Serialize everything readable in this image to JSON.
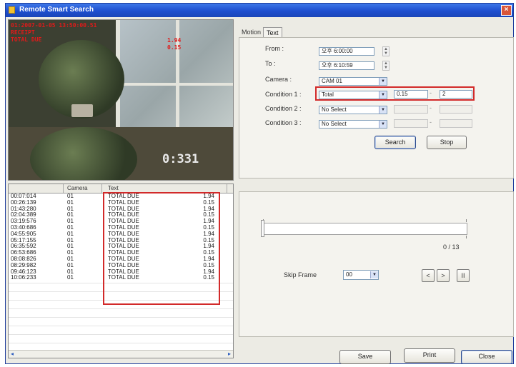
{
  "window": {
    "title": "Remote Smart Search"
  },
  "video": {
    "osd_line1": "01:2007-01-05 13:50:00.51",
    "osd_line2": "RECEIPT",
    "osd_line3": "TOTAL DUE",
    "osd_line4": "",
    "osd_right1": "1.94",
    "osd_right2": "0.15",
    "osd_time": "0:331"
  },
  "list": {
    "columns": [
      "",
      "Camera",
      "Text"
    ],
    "rows": [
      {
        "time": "00:07:014",
        "cam": "01",
        "text": "TOTAL DUE",
        "val": "1.94"
      },
      {
        "time": "00:26:139",
        "cam": "01",
        "text": "TOTAL DUE",
        "val": "0.15"
      },
      {
        "time": "01:43:280",
        "cam": "01",
        "text": "TOTAL DUE",
        "val": "1.94"
      },
      {
        "time": "02:04:389",
        "cam": "01",
        "text": "TOTAL DUE",
        "val": "0.15"
      },
      {
        "time": "03:19:576",
        "cam": "01",
        "text": "TOTAL DUE",
        "val": "1.94"
      },
      {
        "time": "03:40:686",
        "cam": "01",
        "text": "TOTAL DUE",
        "val": "0.15"
      },
      {
        "time": "04:55:905",
        "cam": "01",
        "text": "TOTAL DUE",
        "val": "1.94"
      },
      {
        "time": "05:17:155",
        "cam": "01",
        "text": "TOTAL DUE",
        "val": "0.15"
      },
      {
        "time": "06:35:592",
        "cam": "01",
        "text": "TOTAL DUE",
        "val": "1.94"
      },
      {
        "time": "06:53:686",
        "cam": "01",
        "text": "TOTAL DUE",
        "val": "0.15"
      },
      {
        "time": "08:08:826",
        "cam": "01",
        "text": "TOTAL DUE",
        "val": "1.94"
      },
      {
        "time": "08:29:982",
        "cam": "01",
        "text": "TOTAL DUE",
        "val": "0.15"
      },
      {
        "time": "09:46:123",
        "cam": "01",
        "text": "TOTAL DUE",
        "val": "1.94"
      },
      {
        "time": "10:06:233",
        "cam": "01",
        "text": "TOTAL DUE",
        "val": "0.15"
      }
    ]
  },
  "tabs": [
    "Motion",
    "Text"
  ],
  "form": {
    "from_label": "From :",
    "from_value": "오후 6:00:00",
    "to_label": "To :",
    "to_value": "오후 6:10:59",
    "camera_label": "Camera :",
    "camera_value": "CAM 01",
    "cond1_label": "Condition 1 :",
    "cond1_value": "Total",
    "cond1_from": "0.15",
    "cond1_to": "2",
    "cond2_label": "Condition 2 :",
    "cond2_value": "No Select",
    "cond3_label": "Condition 3 :",
    "cond3_value": "No Select",
    "search_label": "Search",
    "stop_label": "Stop"
  },
  "playback": {
    "counter": "0 / 13",
    "skip_label": "Skip Frame",
    "skip_value": "00",
    "prev_label": "<",
    "next_label": ">",
    "pause_label": "II"
  },
  "footer": {
    "save_label": "Save",
    "print_label": "Print",
    "close_label": "Close"
  },
  "colors": {
    "titlebar": "#1e4fcf",
    "highlight_box": "#d22a2a",
    "osd": "#e01a1a"
  }
}
